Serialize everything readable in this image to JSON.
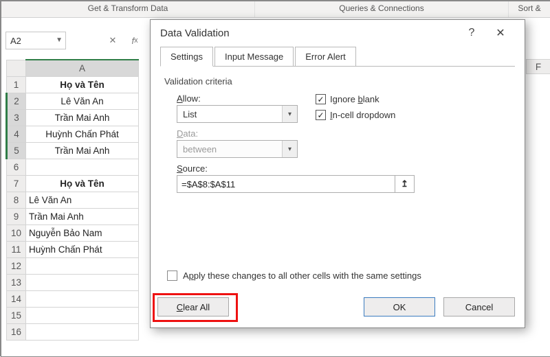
{
  "ribbon": {
    "group1": "Get & Transform Data",
    "group2": "Queries & Connections",
    "group3": "Sort &"
  },
  "namebox": {
    "value": "A2"
  },
  "columns": {
    "A": "A",
    "F": "F"
  },
  "rows": {
    "r1": {
      "n": "1",
      "A": "Họ và Tên"
    },
    "r2": {
      "n": "2",
      "A": "Lê Văn An"
    },
    "r3": {
      "n": "3",
      "A": "Trần Mai Anh"
    },
    "r4": {
      "n": "4",
      "A": "Huỳnh Chấn Phát"
    },
    "r5": {
      "n": "5",
      "A": "Trần Mai Anh"
    },
    "r6": {
      "n": "6",
      "A": ""
    },
    "r7": {
      "n": "7",
      "A": "Họ và Tên"
    },
    "r8": {
      "n": "8",
      "A": "Lê Văn An"
    },
    "r9": {
      "n": "9",
      "A": "Trần Mai Anh"
    },
    "r10": {
      "n": "10",
      "A": "Nguyễn Bảo Nam"
    },
    "r11": {
      "n": "11",
      "A": "Huỳnh Chấn Phát"
    },
    "r12": {
      "n": "12",
      "A": ""
    },
    "r13": {
      "n": "13",
      "A": ""
    },
    "r14": {
      "n": "14",
      "A": ""
    },
    "r15": {
      "n": "15",
      "A": ""
    },
    "r16": {
      "n": "16",
      "A": ""
    }
  },
  "dialog": {
    "title": "Data Validation",
    "help": "?",
    "tabs": {
      "settings": "Settings",
      "input": "Input Message",
      "error": "Error Alert"
    },
    "groupTitle": "Validation criteria",
    "allowLabel": "Allow:",
    "allowValue": "List",
    "dataLabel": "Data:",
    "dataValue": "between",
    "ignoreBlank": "Ignore blank",
    "inCellDropdown": "In-cell dropdown",
    "sourceLabel": "Source:",
    "sourceValue": "=$A$8:$A$11",
    "applyAll": "Apply these changes to all other cells with the same settings",
    "clearAll": "Clear All",
    "ok": "OK",
    "cancel": "Cancel"
  }
}
